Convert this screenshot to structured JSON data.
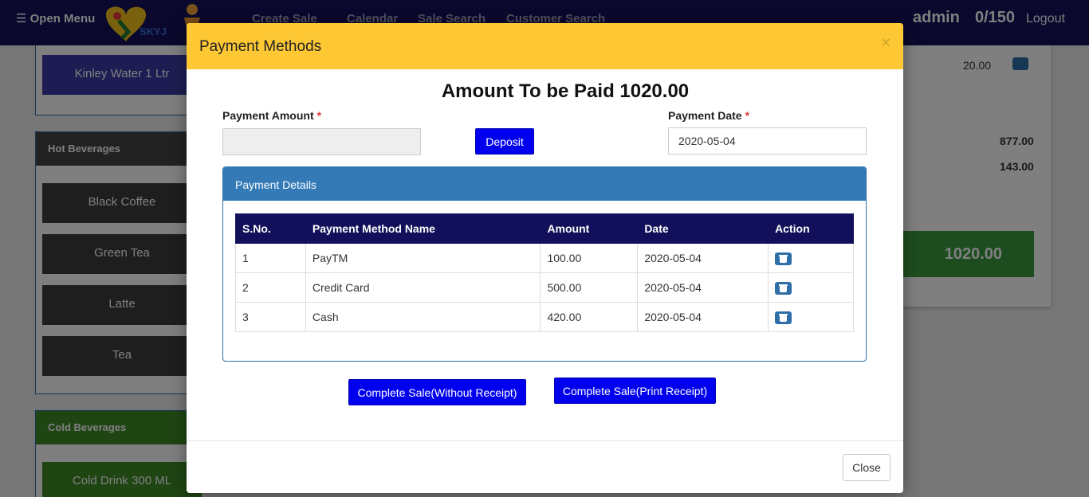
{
  "navbar": {
    "menu_label": "☰ Open Menu",
    "links": [
      "Create Sale",
      "Calendar",
      "Sale Search",
      "Customer Search"
    ],
    "user": "admin",
    "counter": "0/150",
    "logout": "Logout"
  },
  "categories": {
    "top_product": "Kinley Water 1 Ltr",
    "hot": {
      "title": "Hot Beverages",
      "items": [
        "Black Coffee",
        "Green Tea",
        "Latte",
        "Tea"
      ]
    },
    "cold": {
      "title": "Cold Beverages",
      "items": [
        "Cold Drink 300 ML"
      ]
    }
  },
  "cart": {
    "row_price": "20.00",
    "subtotal": "877.00",
    "tax": "143.00",
    "total": "1020.00"
  },
  "modal": {
    "title": "Payment Methods",
    "close_x": "×",
    "amount_heading": "Amount To be Paid 1020.00",
    "payment_amount_label": "Payment Amount",
    "payment_amount_value": "",
    "required_mark": "*",
    "deposit_label": "Deposit",
    "payment_date_label": "Payment Date",
    "payment_date_value": "2020-05-04",
    "details_title": "Payment Details",
    "table": {
      "headers": [
        "S.No.",
        "Payment Method Name",
        "Amount",
        "Date",
        "Action"
      ],
      "rows": [
        {
          "sno": "1",
          "method": "PayTM",
          "amount": "100.00",
          "date": "2020-05-04"
        },
        {
          "sno": "2",
          "method": "Credit Card",
          "amount": "500.00",
          "date": "2020-05-04"
        },
        {
          "sno": "3",
          "method": "Cash",
          "amount": "420.00",
          "date": "2020-05-04"
        }
      ]
    },
    "complete_without_receipt": "Complete Sale(Without Receipt)",
    "complete_print_receipt": "Complete Sale(Print Receipt)",
    "close_label": "Close"
  },
  "colors": {
    "navbar": "#14115a",
    "modal_header": "#fec734",
    "primary_button": "#0000ee",
    "panel_header": "#337ab7",
    "table_header": "#12105a",
    "total_box": "#3a9a3e"
  },
  "icons": {
    "menu": "hamburger-icon",
    "logo": "skyjumper-logo",
    "delete": "trash-icon"
  }
}
